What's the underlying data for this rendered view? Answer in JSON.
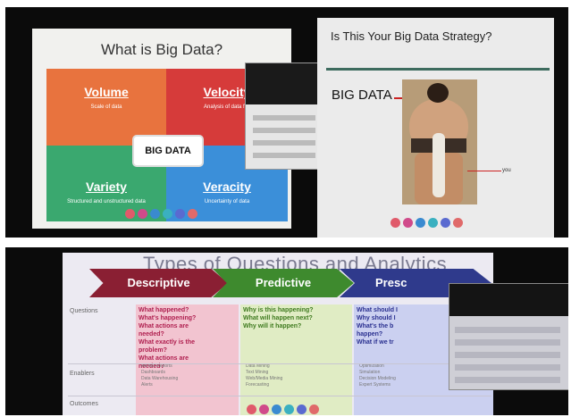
{
  "top_left_slide": {
    "title": "What is Big Data?",
    "center_label": "BIG DATA",
    "quadrants": [
      {
        "label": "Volume",
        "sub": "Scale of data",
        "color": "#e8733e"
      },
      {
        "label": "Velocity",
        "sub": "Analysis of data fl...",
        "color": "#d63b3a"
      },
      {
        "label": "Variety",
        "sub": "Structured and unstructured data",
        "color": "#3aa86f"
      },
      {
        "label": "Veracity",
        "sub": "Uncertainty of data",
        "color": "#3b8fd9"
      }
    ]
  },
  "top_right_slide": {
    "title": "Is This Your Big Data Strategy?",
    "big_data_label": "BIG DATA",
    "you_label": "you"
  },
  "bottom_slide": {
    "title": "Types of Questions and Analytics",
    "stages": [
      "Descriptive",
      "Predictive",
      "Presc"
    ],
    "row_labels": [
      "Questions",
      "Enablers",
      "Outcomes"
    ],
    "descriptive_questions": "What happened?\nWhat's happening?\nWhat actions are\nneeded?\nWhat exactly is the\nproblem?\nWhat actions are\nneeded?",
    "predictive_questions": "Why is this happening?\nWhat will happen next?\nWhy will it happen?",
    "prescriptive_questions": "What should I\nWhy should I\nWhat's the b\nhappen?\nWhat if we tr",
    "descriptive_enablers": "Ad-hoc Reports\nDashboards\nData Warehousing\nAlerts",
    "predictive_enablers": "Data Mining\nText Mining\nWeb/Media Mining\nForecasting",
    "prescriptive_enablers": "Optimization\nSimulation\nDecision Modeling\nExpert Systems"
  },
  "toolbar_colors": [
    "#e05a6a",
    "#d04a8a",
    "#3a8ad0",
    "#3ab0c0",
    "#5a6ad0",
    "#e06a6a"
  ]
}
